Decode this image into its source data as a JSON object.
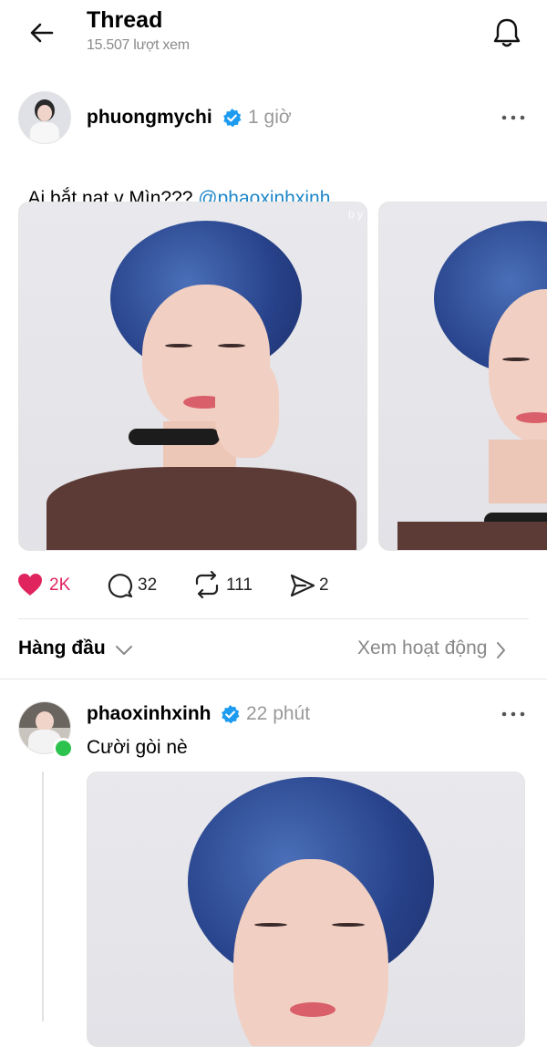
{
  "header": {
    "title": "Thread",
    "subtitle": "15.507 lượt xem"
  },
  "post": {
    "username": "phuongmychi",
    "time": "1 giờ",
    "text": "Ai bắt nạt v Mìn??? ",
    "mention": "@phaoxinhxinh",
    "watermark": "b y",
    "actions": {
      "likes": "2K",
      "comments": "32",
      "reposts": "111",
      "shares": "2"
    }
  },
  "sort": {
    "label": "Hàng đầu",
    "activity_label": "Xem hoạt động"
  },
  "reply": {
    "username": "phaoxinhxinh",
    "time": "22 phút",
    "text": "Cười gòi nè"
  },
  "colors": {
    "like_red": "#e0245e",
    "verified_blue": "#1d9bf0",
    "mention_blue": "#1d86c9",
    "online_green": "#2bc24d",
    "muted": "#999999"
  },
  "icons": [
    "back-arrow-icon",
    "bell-icon",
    "verified-icon",
    "more-icon",
    "heart-icon",
    "comment-icon",
    "repost-icon",
    "share-icon",
    "chevron-down-icon",
    "chevron-right-icon"
  ]
}
